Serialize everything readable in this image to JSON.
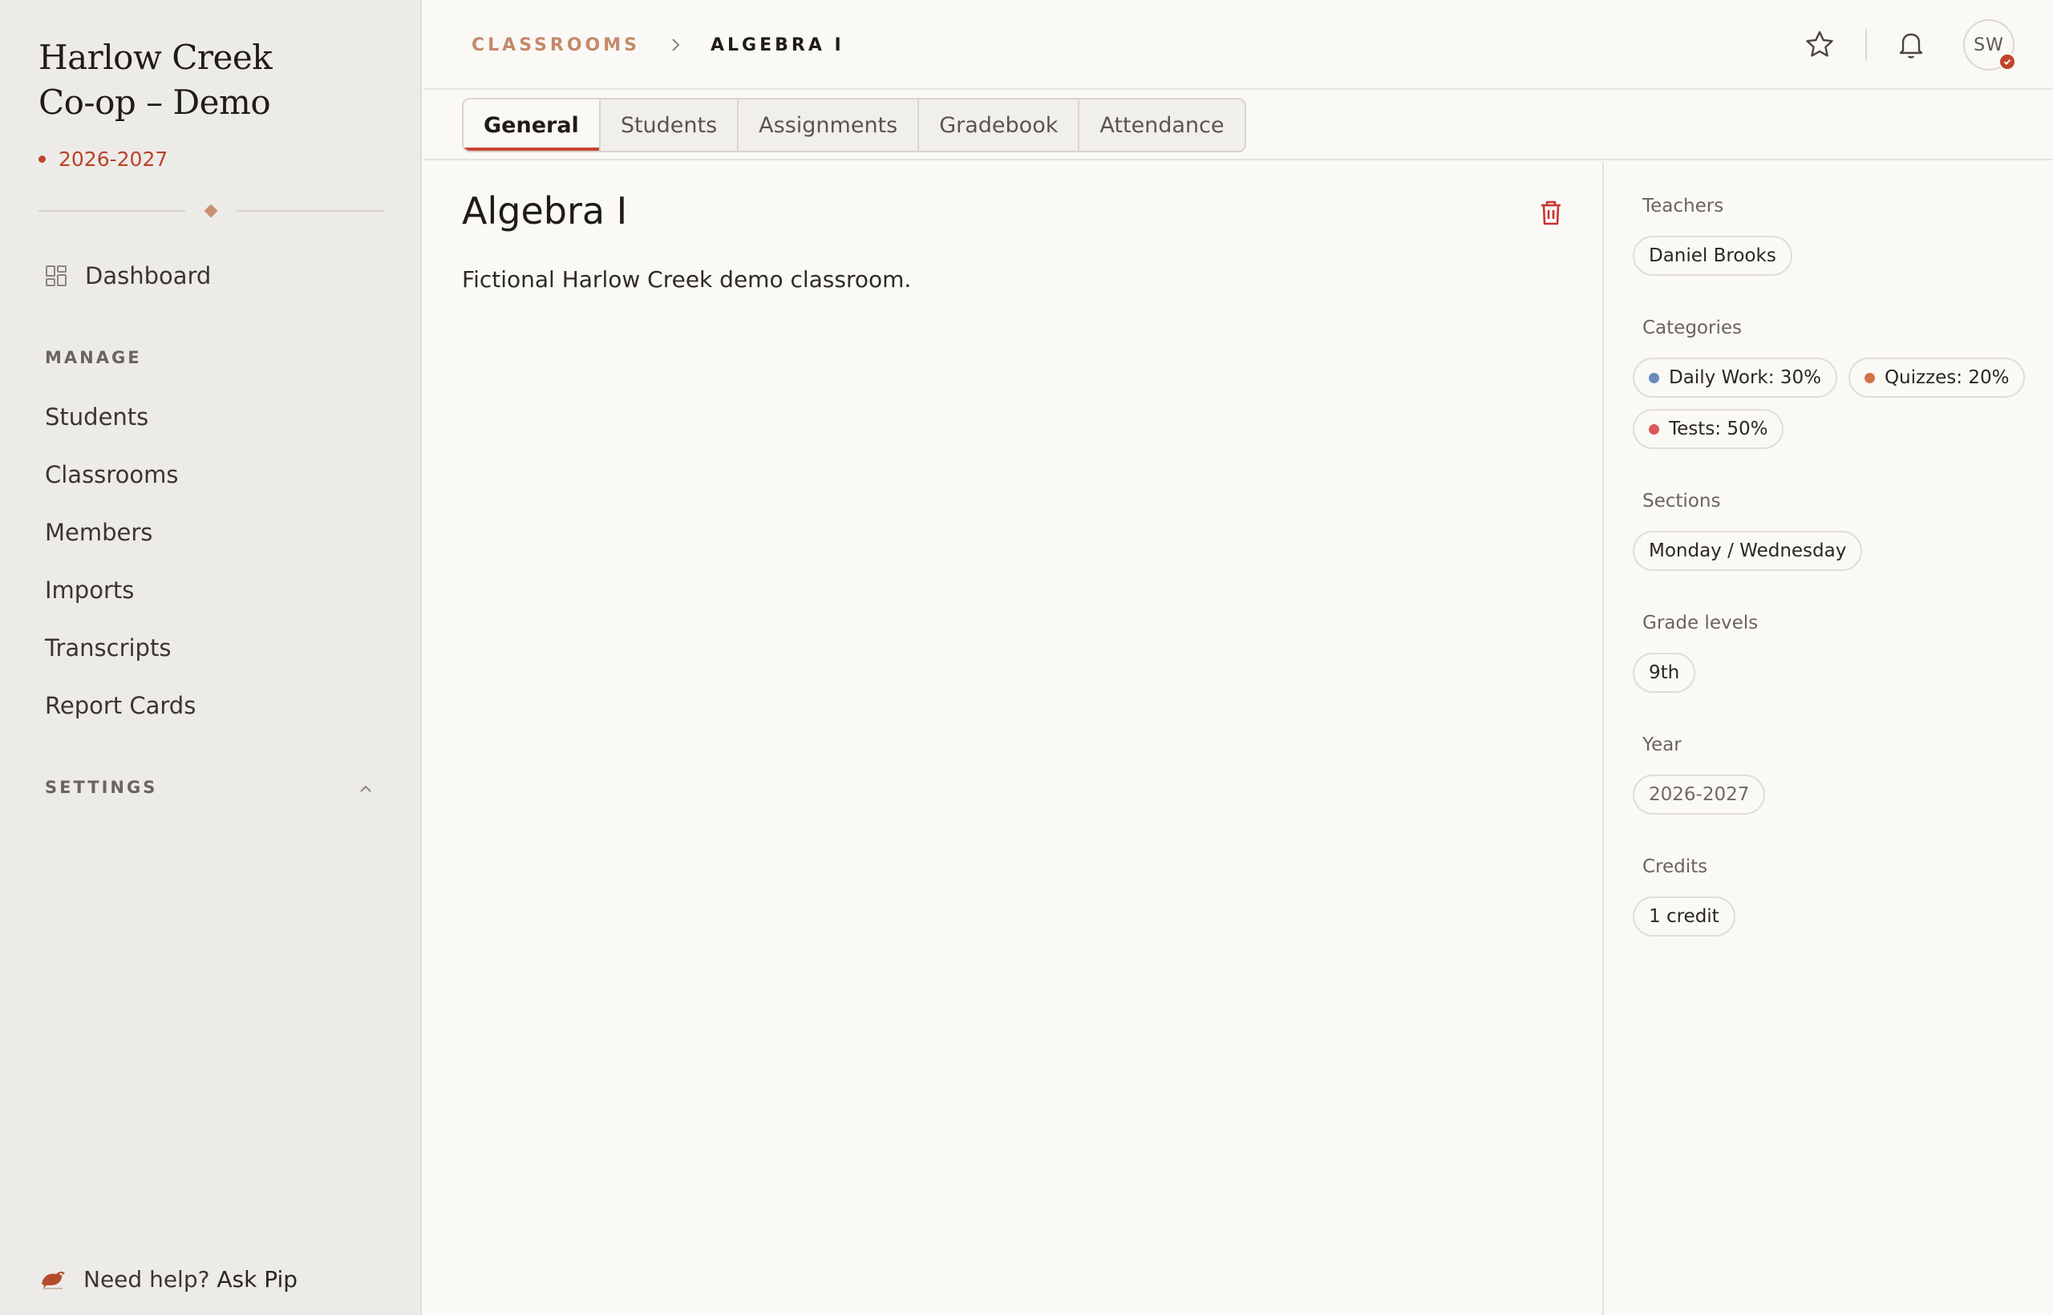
{
  "sidebar": {
    "org_line1": "Harlow Creek",
    "org_line2": "Co-op – Demo",
    "year": "2026-2027",
    "dashboard": "Dashboard",
    "manage_label": "MANAGE",
    "items": [
      "Students",
      "Classrooms",
      "Members",
      "Imports",
      "Transcripts",
      "Report Cards"
    ],
    "settings_label": "SETTINGS",
    "help_prefix": "Need help?",
    "help_link": "Ask Pip"
  },
  "header": {
    "breadcrumb_parent": "CLASSROOMS",
    "breadcrumb_current": "ALGEBRA I",
    "avatar_initials": "SW"
  },
  "tabs": [
    "General",
    "Students",
    "Assignments",
    "Gradebook",
    "Attendance"
  ],
  "main": {
    "title": "Algebra I",
    "description": "Fictional Harlow Creek demo classroom."
  },
  "details": {
    "teachers_label": "Teachers",
    "teachers": [
      "Daniel Brooks"
    ],
    "categories_label": "Categories",
    "categories": [
      {
        "label": "Daily Work: 30%",
        "color": "#6b8bbd"
      },
      {
        "label": "Quizzes: 20%",
        "color": "#d0764a"
      },
      {
        "label": "Tests: 50%",
        "color": "#d65a5a"
      }
    ],
    "sections_label": "Sections",
    "sections": [
      "Monday / Wednesday"
    ],
    "grade_levels_label": "Grade levels",
    "grade_levels": [
      "9th"
    ],
    "year_label": "Year",
    "year": "2026-2027",
    "credits_label": "Credits",
    "credits": "1 credit"
  },
  "colors": {
    "accent": "#c0452c",
    "breadcrumb_link": "#c5896a"
  }
}
